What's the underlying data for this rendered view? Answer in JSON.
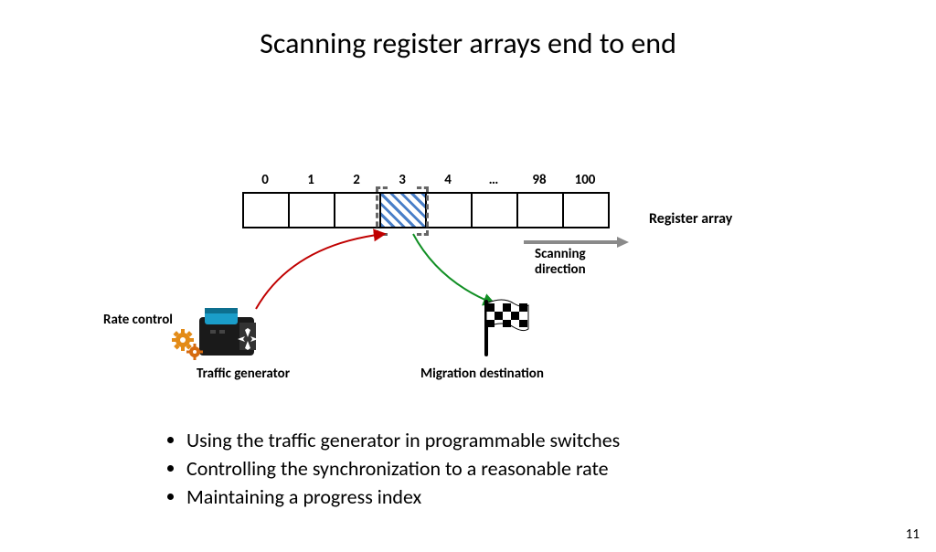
{
  "title": "Scanning register arrays end to end",
  "array": {
    "indices": [
      "0",
      "1",
      "2",
      "3",
      "4",
      "…",
      "98",
      "100"
    ],
    "highlight_index": 3,
    "label": "Register array"
  },
  "scan": {
    "label": "Scanning\ndirection"
  },
  "rate_control_label": "Rate control",
  "traffic_generator_label": "Traffic generator",
  "migration_label": "Migration destination",
  "bullets": [
    "Using the traffic generator in programmable switches",
    "Controlling the synchronization to a reasonable rate",
    "Maintaining a progress index"
  ],
  "page_number": "11"
}
